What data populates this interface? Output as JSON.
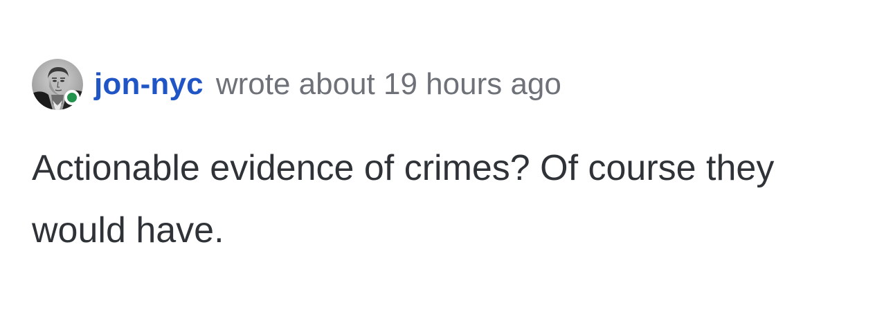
{
  "comment": {
    "author": {
      "username": "jon-nyc",
      "avatar_icon": "user-avatar-photo",
      "online": true
    },
    "meta_text": "wrote about 19 hours ago",
    "body": "Actionable evidence of crimes? Of course they would have."
  },
  "colors": {
    "username": "#1f55c4",
    "online_dot": "#22944e",
    "meta_text": "#6e7178",
    "body_text": "#2f3338"
  }
}
